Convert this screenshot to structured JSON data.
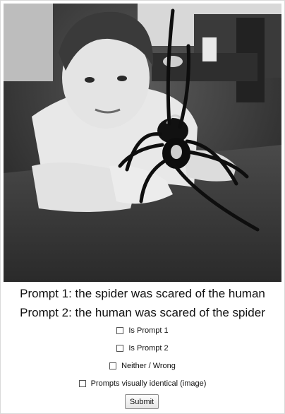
{
  "prompts": {
    "prompt1": "Prompt 1: the spider was scared of the human",
    "prompt2": "Prompt 2: the human was scared of the spider"
  },
  "options": {
    "is_prompt1": "Is Prompt 1",
    "is_prompt2": "Is Prompt 2",
    "neither_wrong": "Neither / Wrong",
    "visually_identical": "Prompts visually identical (image)"
  },
  "submit_label": "Submit",
  "image": {
    "subject": "black-and-white photo of a boy at a table with a large spider",
    "style": "grayscale"
  }
}
